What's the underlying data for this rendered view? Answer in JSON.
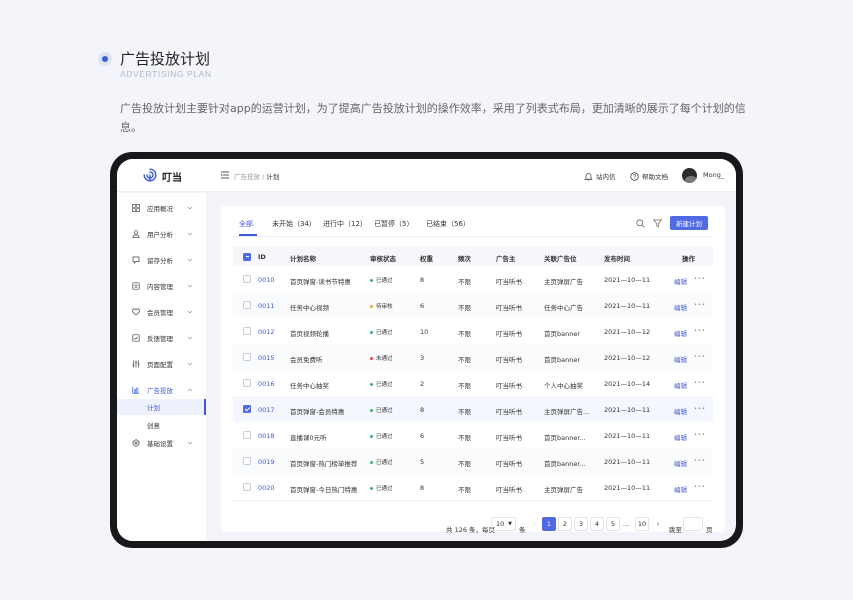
{
  "section": {
    "title": "广告投放计划",
    "subtitle": "ADVERTISING PLAN",
    "description": "广告投放计划主要针对app的运营计划，为了提高广告投放计划的操作效率，采用了列表式布局，更加清晰的展示了每个计划的信息。"
  },
  "app": {
    "name": "叮当",
    "breadcrumb": [
      "广告投放",
      "计划"
    ],
    "notifications_label": "站内信",
    "help_label": "帮助文档",
    "user_name": "Mong_"
  },
  "sidebar": {
    "items": [
      {
        "label": "应用概况",
        "icon": "grid-icon"
      },
      {
        "label": "用户分析",
        "icon": "user-icon"
      },
      {
        "label": "留存分析",
        "icon": "retention-icon"
      },
      {
        "label": "内容管理",
        "icon": "content-icon"
      },
      {
        "label": "会员管理",
        "icon": "member-icon"
      },
      {
        "label": "反馈管理",
        "icon": "feedback-icon"
      },
      {
        "label": "页面配置",
        "icon": "sliders-icon"
      },
      {
        "label": "广告投放",
        "icon": "ad-chart-icon"
      },
      {
        "label": "基础设置",
        "icon": "gear-icon"
      }
    ],
    "ad_sub": [
      "计划",
      "创意"
    ]
  },
  "tabs": [
    {
      "label": "全部"
    },
    {
      "label": "未开始（34）"
    },
    {
      "label": "进行中（12）"
    },
    {
      "label": "已暂停（5）"
    },
    {
      "label": "已结束（56）"
    }
  ],
  "new_button": "新建计划",
  "table": {
    "columns": [
      "ID",
      "计划名称",
      "审核状态",
      "权重",
      "频次",
      "广告主",
      "关联广告位",
      "发布时间",
      "操作"
    ],
    "rows": [
      {
        "id": "0010",
        "name": "首页弹窗-读书节特惠",
        "status": "已通过",
        "weight": "8",
        "freq": "不限",
        "advertiser": "叮当听书",
        "slot": "主页弹屏广告",
        "date": "2021—10—11",
        "edit": "编辑",
        "checked": false
      },
      {
        "id": "0011",
        "name": "任务中心视频",
        "status": "待审核",
        "weight": "6",
        "freq": "不限",
        "advertiser": "叮当听书",
        "slot": "任务中心广告",
        "date": "2021—10—11",
        "edit": "编辑",
        "checked": false
      },
      {
        "id": "0012",
        "name": "首页视频轮播",
        "status": "已通过",
        "weight": "10",
        "freq": "不限",
        "advertiser": "叮当听书",
        "slot": "首页banner",
        "date": "2021—10—12",
        "edit": "编辑",
        "checked": false
      },
      {
        "id": "0015",
        "name": "会员免费听",
        "status": "未通过",
        "weight": "3",
        "freq": "不限",
        "advertiser": "叮当听书",
        "slot": "首页banner",
        "date": "2021—10—12",
        "edit": "编辑",
        "checked": false
      },
      {
        "id": "0016",
        "name": "任务中心抽奖",
        "status": "已通过",
        "weight": "2",
        "freq": "不限",
        "advertiser": "叮当听书",
        "slot": "个人中心抽奖",
        "date": "2021—10—14",
        "edit": "编辑",
        "checked": false
      },
      {
        "id": "0017",
        "name": "首页弹窗-会员特惠",
        "status": "已通过",
        "weight": "8",
        "freq": "不限",
        "advertiser": "叮当听书",
        "slot": "主页弹屏广告...",
        "date": "2021—10—11",
        "edit": "编辑",
        "checked": true
      },
      {
        "id": "0018",
        "name": "直播课0元听",
        "status": "已通过",
        "weight": "6",
        "freq": "不限",
        "advertiser": "叮当听书",
        "slot": "首页banner...",
        "date": "2021—10—11",
        "edit": "编辑",
        "checked": false
      },
      {
        "id": "0019",
        "name": "首页弹窗-热门榜单推荐",
        "status": "已通过",
        "weight": "5",
        "freq": "不限",
        "advertiser": "叮当听书",
        "slot": "首页banner...",
        "date": "2021—10—11",
        "edit": "编辑",
        "checked": false
      },
      {
        "id": "0020",
        "name": "首页弹窗-今日热门特惠",
        "status": "已通过",
        "weight": "8",
        "freq": "不限",
        "advertiser": "叮当听书",
        "slot": "主页弹屏广告",
        "date": "2021—10—11",
        "edit": "编辑",
        "checked": false
      }
    ]
  },
  "status_colors": {
    "已通过": "#3bb56c",
    "待审核": "#f0a53c",
    "未通过": "#e5484d"
  },
  "pagination": {
    "total": "共 126 条，每页",
    "page_size": "10",
    "unit": "条",
    "pages": [
      "1",
      "2",
      "3",
      "4",
      "5",
      "...",
      "10"
    ],
    "current": "1",
    "jump_label": "跳至",
    "page_label": "页"
  },
  "accent": "#4f6ae3"
}
